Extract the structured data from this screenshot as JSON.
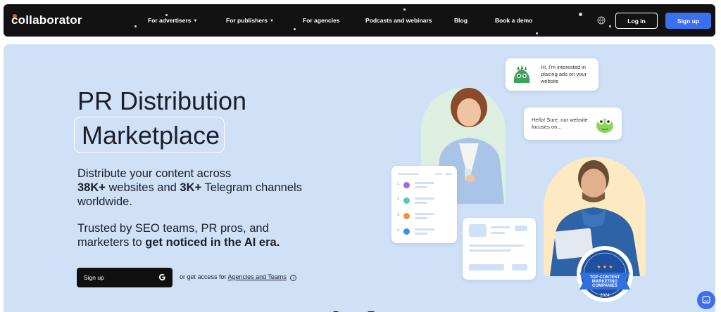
{
  "nav": {
    "logo": "collaborator",
    "items": [
      {
        "label": "For advertisers",
        "dropdown": true
      },
      {
        "label": "For publishers",
        "dropdown": true
      },
      {
        "label": "For agencies",
        "dropdown": false
      },
      {
        "label": "Podcasts and webinars",
        "dropdown": false
      },
      {
        "label": "Blog",
        "dropdown": false
      },
      {
        "label": "Book a demo",
        "dropdown": false
      }
    ],
    "login_label": "Log in",
    "signup_label": "Sign up",
    "globe_icon": "globe-icon"
  },
  "hero": {
    "title_line1": "PR Distribution",
    "title_line2": "Marketplace",
    "desc_intro": "Distribute your content across",
    "desc_stat1": "38K+",
    "desc_mid": "websites and",
    "desc_stat2": "3K+",
    "desc_end": "Telegram channels worldwide.",
    "trust_text": "Trusted by SEO teams, PR pros, and marketers to",
    "trust_bold": "get noticed in the AI era.",
    "cta_label": "Sign up",
    "alt_prefix": "or get access for",
    "alt_link": "Agencies and Teams"
  },
  "illustration": {
    "bubble1": "Hi, I'm interested in placing ads on your website",
    "bubble2": "Hello! Sure, our website focuses on...",
    "list_numbers": [
      "1",
      "2",
      "3",
      "4"
    ],
    "badge_line1": "TOP CONTENT",
    "badge_line2": "MARKETING",
    "badge_line3": "COMPANIES",
    "badge_year": "2024"
  },
  "colors": {
    "accent": "#3a6ff0",
    "hero_bg": "#cfe0f7",
    "nav_bg": "#121212"
  }
}
